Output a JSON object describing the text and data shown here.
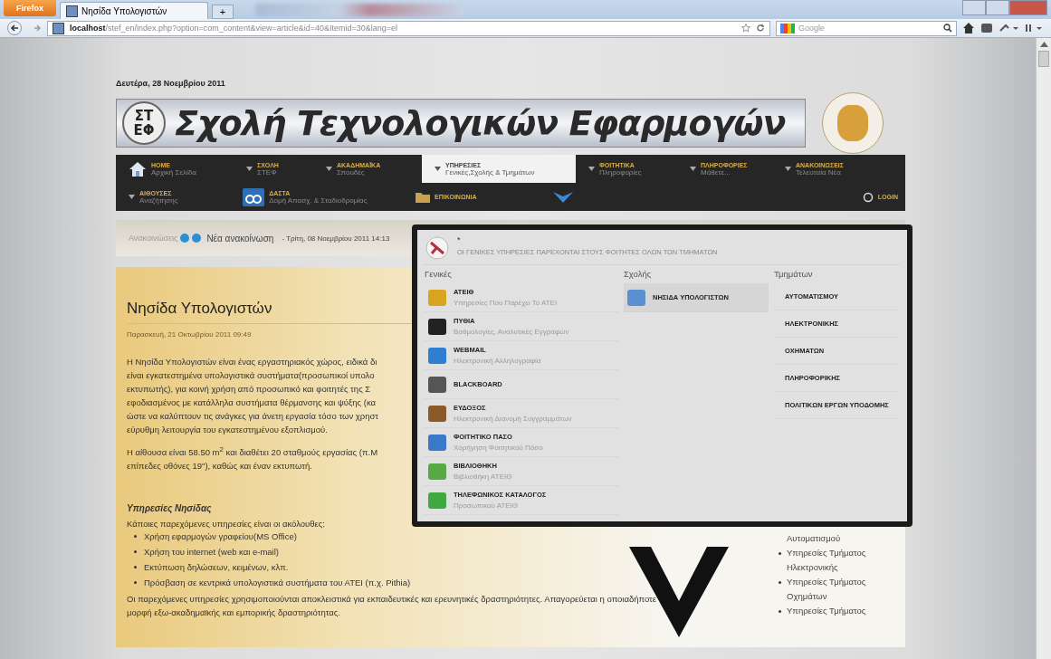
{
  "browser": {
    "menu_button": "Firefox",
    "tabs": [
      {
        "title": "Νησίδα Υπολογιστών",
        "selected": true
      }
    ],
    "new_tab": "+",
    "url": "**localhost**/stef_en/index.php?option=com_content&view=article&id=40&Itemid=30&lang=el",
    "search_engine": "Google"
  },
  "page": {
    "date": "Δευτέρα, 28 Νοεμβρίου 2011",
    "logo_letters": [
      "ΣΤ",
      "ΕΦ"
    ],
    "banner_title": "Σχολή Τεχνολογικών Εφαρμογών"
  },
  "nav_rows": [
    [
      {
        "kind": "home",
        "title": "HOME",
        "subtitle": "Αρχική Σελίδα",
        "selected": false
      },
      {
        "kind": "menu",
        "title": "ΣΧΟΛΗ",
        "subtitle": "ΣΤΕΦ",
        "selected": false
      },
      {
        "kind": "menu",
        "title": "ΑΚΑΔΗΜΑΪΚΑ",
        "subtitle": "Σπουδές",
        "selected": false
      },
      {
        "kind": "menu",
        "title": "ΥΠΗΡΕΣΙΕΣ",
        "subtitle": "Γενικές,Σχολής & Τμημάτων",
        "selected": true
      },
      {
        "kind": "menu",
        "title": "ΦΟΙΤΗΤΙΚΑ",
        "subtitle": "Πληροφορίες",
        "selected": false
      },
      {
        "kind": "menu",
        "title": "ΠΛΗΡΟΦΟΡΙΕΣ",
        "subtitle": "Μάθετε...",
        "selected": false
      },
      {
        "kind": "menu",
        "title": "ΑΝΑΚΟΙΝΩΣΕΙΣ",
        "subtitle": "Τελευταία Νέα",
        "selected": false
      }
    ],
    [
      {
        "kind": "menu",
        "title": "ΑΙΘΟΥΣΕΣ",
        "subtitle": "Αναζήτησης",
        "selected": false
      },
      {
        "kind": "logo",
        "title": "ΔΑΣΤΑ",
        "subtitle": "Δομή Απασχ. & Σταδιοδρομίας",
        "selected": false
      },
      {
        "kind": "folder",
        "title": "ΕΠΙΚΟΙΝΩΝΙΑ",
        "selected": false
      },
      {
        "kind": "bird",
        "selected": false
      },
      {
        "kind": "login",
        "title": "LOGIN",
        "selected": false
      }
    ]
  ],
  "announcement": {
    "label": "Ανακοινώσεις",
    "headline": "Νέα ανακοίνωση",
    "date": "- Τρίτη, 08 Νοεμβρίου 2011 14:13"
  },
  "article": {
    "title": "Νησίδα Υπολογιστών",
    "date": "Παρασκευή, 21 Οκτωβρίου 2011 09:49",
    "paragraphs": [
      [
        "Η Νησίδα Υπολογιστών είναι ένας εργαστηριακός χώρος, ειδικά δι",
        "είναι εγκατεστημένα υπολογιστικά συστήματα(προσωπικοί υπολο",
        "εκτυπωτής), για κοινή χρήση από προσωπικό και φοιτητές της Σ",
        "εφοδιασμένος με κατάλληλα συστήματα θέρμανσης και ψύξης (κα",
        "ώστε να καλύπτουν τις ανάγκες για άνετη εργασία τόσο των χρηστ",
        "εύρυθμη λειτουργία του εγκατεστημένου εξοπλισμού."
      ],
      [
        "Η αίθουσα είναι 58.50 m$^{2}$ και διαθέτει 20 σταθμούς εργασίας (π.Μ",
        "επίπεδες οθόνες 19\"), καθώς και έναν εκτυπωτή."
      ]
    ],
    "subheading": "Υπηρεσίες Νησίδας",
    "intro": "Κάποιες παρεχόμενες υπηρεσίες είναι οι ακόλουθες:",
    "bullets": [
      "Χρήση εφαρμογών γραφείου(MS Office)",
      "Χρήση του internet (web και e-mail)",
      "Εκτύπωση δηλώσεων, κειμένων, κλπ.",
      "Πρόσβαση σε κεντρικά υπολογιστικά συστήματα του ΑΤΕΙ (π.χ. Pithia)"
    ],
    "closing": [
      "Οι παρεχόμενες υπηρεσίες χρησιμοποιούνται αποκλειστικά για εκπαιδευτικές και ερευνητικές δραστηριότητες. Απαγορεύεται η οποιαδήποτε",
      "μορφή εξω-ακαδημαϊκής και εμπορικής δραστηριότητας."
    ]
  },
  "sidebar": [
    {
      "kind": "text",
      "text": "Αυτοματισμού"
    },
    {
      "kind": "bullet",
      "text": "Υπηρεσίες Τμήματος"
    },
    {
      "kind": "text",
      "text": "Ηλεκτρονικής"
    },
    {
      "kind": "bullet",
      "text": "Υπηρεσίες Τμήματος"
    },
    {
      "kind": "text",
      "text": "Οχημάτων"
    },
    {
      "kind": "bullet",
      "text": "Υπηρεσίες Τμήματος"
    }
  ],
  "dropdown": {
    "mark": "*",
    "notice": "ΟΙ ΓΕΝΙΚΕΣ ΥΠΗΡΕΣΙΕΣ ΠΑΡΕΧΟΝΤΑΙ ΣΤΟΥΣ ΦΟΙΤΗΤΕΣ ΟΛΩΝ ΤΩΝ ΤΜΗΜΑΤΩΝ",
    "columns": [
      {
        "heading": "Γενικές",
        "kind": "icons",
        "items": [
          {
            "title": "ΑΤΕΙΘ",
            "subtitle": "Υπηρεσίες Που Παρέχει Το ΑΤΕΙ",
            "selected": false
          },
          {
            "title": "ΠΥΘΙΑ",
            "subtitle": "Βαθμολογίες, Αναλυτικές Εγγραφών",
            "selected": false
          },
          {
            "title": "WEBMAIL",
            "subtitle": "Ηλεκτρονική Αλληλογραφία",
            "selected": false
          },
          {
            "title": "BLACKBOARD",
            "selected": false
          },
          {
            "title": "ΕΥΔΟΞΟΣ",
            "subtitle": "Ηλεκτρονική Διανομή Συγγραμμάτων",
            "selected": false
          },
          {
            "title": "ΦΟΙΤΗΤΙΚΟ ΠΑΣΟ",
            "subtitle": "Χορήγηση Φοιτητικού Πάσο",
            "selected": false
          },
          {
            "title": "ΒΙΒΛΙΟΘΗΚΗ",
            "subtitle": "Βιβλιοθήκη ΑΤΕΙΘ",
            "selected": false
          },
          {
            "title": "ΤΗΛΕΦΩΝΙΚΟΣ ΚΑΤΑΛΟΓΟΣ",
            "subtitle": "Προσωπικού ΑΤΕΙΘ",
            "selected": false
          }
        ]
      },
      {
        "heading": "Σχολής",
        "kind": "icons",
        "items": [
          {
            "title": "ΝΗΣΙΔΑ ΥΠΟΛΟΓΙΣΤΩΝ",
            "selected": true
          }
        ]
      },
      {
        "heading": "Τμημάτων",
        "kind": "plain",
        "items": [
          {
            "title": "ΑΥΤΟΜΑΤΙΣΜΟΥ",
            "selected": false
          },
          {
            "title": "ΗΛΕΚΤΡΟΝΙΚΗΣ",
            "selected": false
          },
          {
            "title": "ΟΧΗΜΑΤΩΝ",
            "selected": false
          },
          {
            "title": "ΠΛΗΡΟΦΟΡΙΚΗΣ",
            "selected": false
          },
          {
            "title": "ΠΟΛΙΤΙΚΩΝ ΕΡΓΩΝ ΥΠΟΔΟΜΗΣ",
            "selected": false
          }
        ]
      }
    ]
  }
}
